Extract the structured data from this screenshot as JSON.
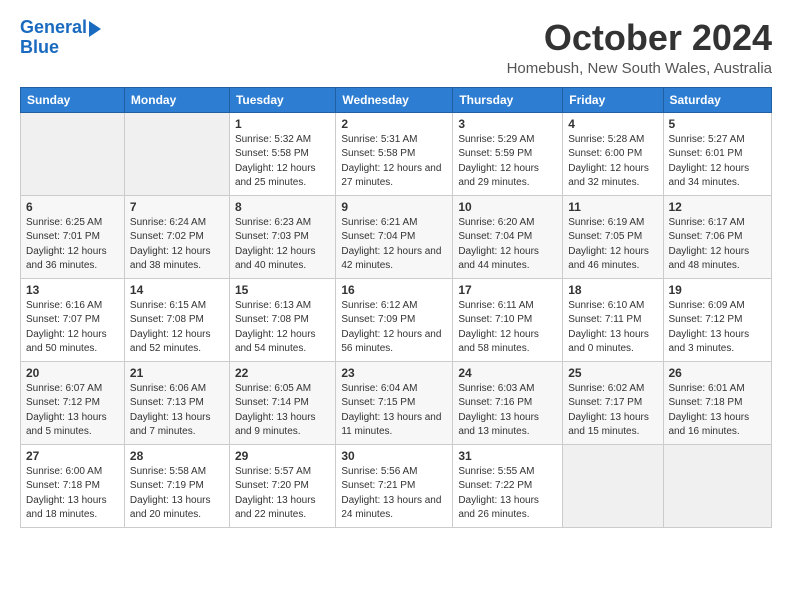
{
  "logo": {
    "line1": "General",
    "line2": "Blue"
  },
  "title": "October 2024",
  "subtitle": "Homebush, New South Wales, Australia",
  "days_header": [
    "Sunday",
    "Monday",
    "Tuesday",
    "Wednesday",
    "Thursday",
    "Friday",
    "Saturday"
  ],
  "weeks": [
    [
      {
        "day": "",
        "sunrise": "",
        "sunset": "",
        "daylight": ""
      },
      {
        "day": "",
        "sunrise": "",
        "sunset": "",
        "daylight": ""
      },
      {
        "day": "1",
        "sunrise": "Sunrise: 5:32 AM",
        "sunset": "Sunset: 5:58 PM",
        "daylight": "Daylight: 12 hours and 25 minutes."
      },
      {
        "day": "2",
        "sunrise": "Sunrise: 5:31 AM",
        "sunset": "Sunset: 5:58 PM",
        "daylight": "Daylight: 12 hours and 27 minutes."
      },
      {
        "day": "3",
        "sunrise": "Sunrise: 5:29 AM",
        "sunset": "Sunset: 5:59 PM",
        "daylight": "Daylight: 12 hours and 29 minutes."
      },
      {
        "day": "4",
        "sunrise": "Sunrise: 5:28 AM",
        "sunset": "Sunset: 6:00 PM",
        "daylight": "Daylight: 12 hours and 32 minutes."
      },
      {
        "day": "5",
        "sunrise": "Sunrise: 5:27 AM",
        "sunset": "Sunset: 6:01 PM",
        "daylight": "Daylight: 12 hours and 34 minutes."
      }
    ],
    [
      {
        "day": "6",
        "sunrise": "Sunrise: 6:25 AM",
        "sunset": "Sunset: 7:01 PM",
        "daylight": "Daylight: 12 hours and 36 minutes."
      },
      {
        "day": "7",
        "sunrise": "Sunrise: 6:24 AM",
        "sunset": "Sunset: 7:02 PM",
        "daylight": "Daylight: 12 hours and 38 minutes."
      },
      {
        "day": "8",
        "sunrise": "Sunrise: 6:23 AM",
        "sunset": "Sunset: 7:03 PM",
        "daylight": "Daylight: 12 hours and 40 minutes."
      },
      {
        "day": "9",
        "sunrise": "Sunrise: 6:21 AM",
        "sunset": "Sunset: 7:04 PM",
        "daylight": "Daylight: 12 hours and 42 minutes."
      },
      {
        "day": "10",
        "sunrise": "Sunrise: 6:20 AM",
        "sunset": "Sunset: 7:04 PM",
        "daylight": "Daylight: 12 hours and 44 minutes."
      },
      {
        "day": "11",
        "sunrise": "Sunrise: 6:19 AM",
        "sunset": "Sunset: 7:05 PM",
        "daylight": "Daylight: 12 hours and 46 minutes."
      },
      {
        "day": "12",
        "sunrise": "Sunrise: 6:17 AM",
        "sunset": "Sunset: 7:06 PM",
        "daylight": "Daylight: 12 hours and 48 minutes."
      }
    ],
    [
      {
        "day": "13",
        "sunrise": "Sunrise: 6:16 AM",
        "sunset": "Sunset: 7:07 PM",
        "daylight": "Daylight: 12 hours and 50 minutes."
      },
      {
        "day": "14",
        "sunrise": "Sunrise: 6:15 AM",
        "sunset": "Sunset: 7:08 PM",
        "daylight": "Daylight: 12 hours and 52 minutes."
      },
      {
        "day": "15",
        "sunrise": "Sunrise: 6:13 AM",
        "sunset": "Sunset: 7:08 PM",
        "daylight": "Daylight: 12 hours and 54 minutes."
      },
      {
        "day": "16",
        "sunrise": "Sunrise: 6:12 AM",
        "sunset": "Sunset: 7:09 PM",
        "daylight": "Daylight: 12 hours and 56 minutes."
      },
      {
        "day": "17",
        "sunrise": "Sunrise: 6:11 AM",
        "sunset": "Sunset: 7:10 PM",
        "daylight": "Daylight: 12 hours and 58 minutes."
      },
      {
        "day": "18",
        "sunrise": "Sunrise: 6:10 AM",
        "sunset": "Sunset: 7:11 PM",
        "daylight": "Daylight: 13 hours and 0 minutes."
      },
      {
        "day": "19",
        "sunrise": "Sunrise: 6:09 AM",
        "sunset": "Sunset: 7:12 PM",
        "daylight": "Daylight: 13 hours and 3 minutes."
      }
    ],
    [
      {
        "day": "20",
        "sunrise": "Sunrise: 6:07 AM",
        "sunset": "Sunset: 7:12 PM",
        "daylight": "Daylight: 13 hours and 5 minutes."
      },
      {
        "day": "21",
        "sunrise": "Sunrise: 6:06 AM",
        "sunset": "Sunset: 7:13 PM",
        "daylight": "Daylight: 13 hours and 7 minutes."
      },
      {
        "day": "22",
        "sunrise": "Sunrise: 6:05 AM",
        "sunset": "Sunset: 7:14 PM",
        "daylight": "Daylight: 13 hours and 9 minutes."
      },
      {
        "day": "23",
        "sunrise": "Sunrise: 6:04 AM",
        "sunset": "Sunset: 7:15 PM",
        "daylight": "Daylight: 13 hours and 11 minutes."
      },
      {
        "day": "24",
        "sunrise": "Sunrise: 6:03 AM",
        "sunset": "Sunset: 7:16 PM",
        "daylight": "Daylight: 13 hours and 13 minutes."
      },
      {
        "day": "25",
        "sunrise": "Sunrise: 6:02 AM",
        "sunset": "Sunset: 7:17 PM",
        "daylight": "Daylight: 13 hours and 15 minutes."
      },
      {
        "day": "26",
        "sunrise": "Sunrise: 6:01 AM",
        "sunset": "Sunset: 7:18 PM",
        "daylight": "Daylight: 13 hours and 16 minutes."
      }
    ],
    [
      {
        "day": "27",
        "sunrise": "Sunrise: 6:00 AM",
        "sunset": "Sunset: 7:18 PM",
        "daylight": "Daylight: 13 hours and 18 minutes."
      },
      {
        "day": "28",
        "sunrise": "Sunrise: 5:58 AM",
        "sunset": "Sunset: 7:19 PM",
        "daylight": "Daylight: 13 hours and 20 minutes."
      },
      {
        "day": "29",
        "sunrise": "Sunrise: 5:57 AM",
        "sunset": "Sunset: 7:20 PM",
        "daylight": "Daylight: 13 hours and 22 minutes."
      },
      {
        "day": "30",
        "sunrise": "Sunrise: 5:56 AM",
        "sunset": "Sunset: 7:21 PM",
        "daylight": "Daylight: 13 hours and 24 minutes."
      },
      {
        "day": "31",
        "sunrise": "Sunrise: 5:55 AM",
        "sunset": "Sunset: 7:22 PM",
        "daylight": "Daylight: 13 hours and 26 minutes."
      },
      {
        "day": "",
        "sunrise": "",
        "sunset": "",
        "daylight": ""
      },
      {
        "day": "",
        "sunrise": "",
        "sunset": "",
        "daylight": ""
      }
    ]
  ]
}
